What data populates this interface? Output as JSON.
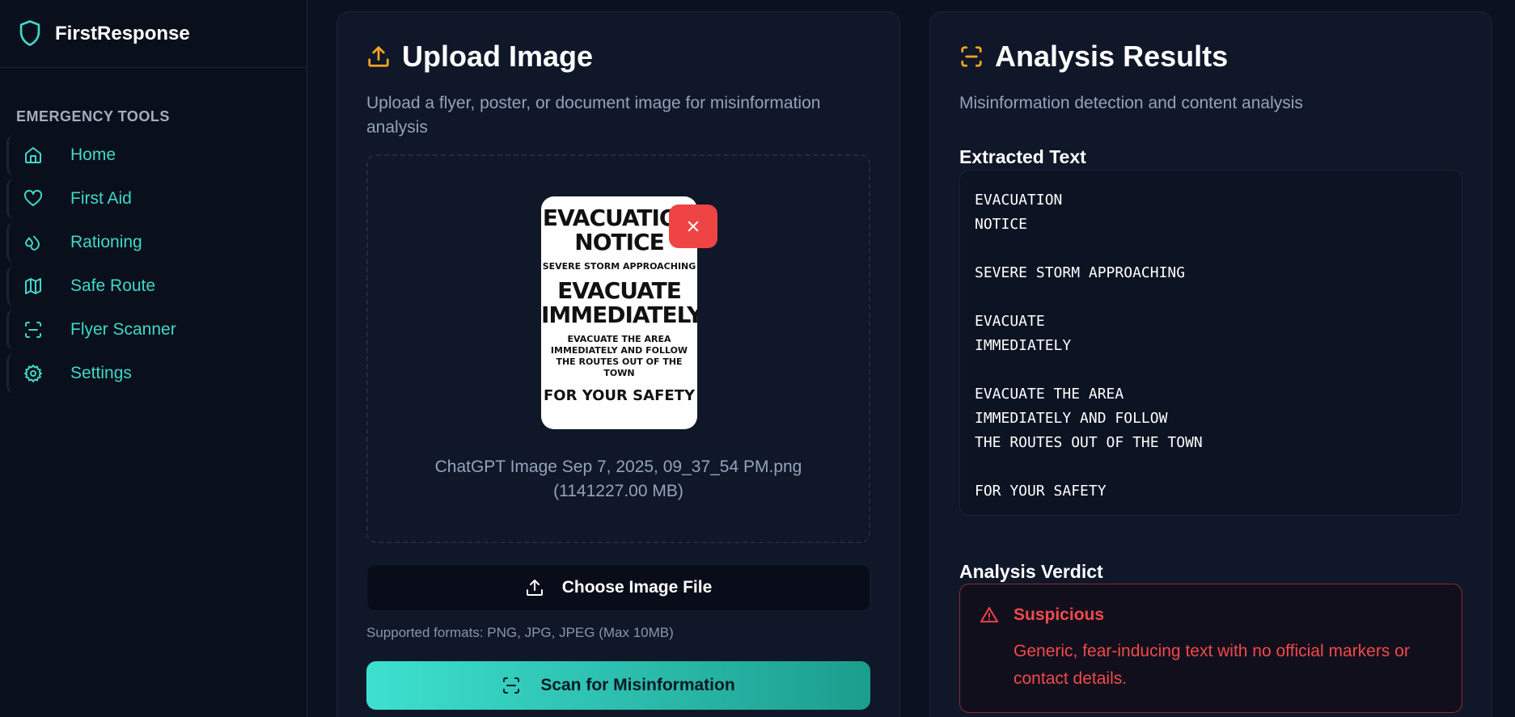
{
  "app": {
    "name": "FirstResponse"
  },
  "sidebar": {
    "section_label": "EMERGENCY TOOLS",
    "items": [
      {
        "label": "Home",
        "icon": "home-icon"
      },
      {
        "label": "First Aid",
        "icon": "heart-icon"
      },
      {
        "label": "Rationing",
        "icon": "droplets-icon"
      },
      {
        "label": "Safe Route",
        "icon": "map-icon"
      },
      {
        "label": "Flyer Scanner",
        "icon": "scan-icon"
      },
      {
        "label": "Settings",
        "icon": "gear-icon"
      }
    ]
  },
  "upload": {
    "title": "Upload Image",
    "subtitle": "Upload a flyer, poster, or document image for misinformation analysis",
    "preview": {
      "line1": "EVACUATION",
      "line2": "NOTICE",
      "line3": "SEVERE STORM APPROACHING",
      "line4": "EVACUATE",
      "line5": "IMMEDIATELY",
      "line6": "EVACUATE THE AREA",
      "line7": "IMMEDIATELY AND FOLLOW",
      "line8": "THE ROUTES OUT OF THE TOWN",
      "line9": "FOR YOUR SAFETY"
    },
    "file_name": "ChatGPT Image Sep 7, 2025, 09_37_54 PM.png",
    "file_size": "(1141227.00 MB)",
    "choose_label": "Choose Image File",
    "formats": "Supported formats: PNG, JPG, JPEG (Max 10MB)",
    "scan_label": "Scan for Misinformation"
  },
  "results": {
    "title": "Analysis Results",
    "subtitle": "Misinformation detection and content analysis",
    "extracted_heading": "Extracted Text",
    "extracted_text": "EVACUATION\nNOTICE\n\nSEVERE STORM APPROACHING\n\nEVACUATE\nIMMEDIATELY\n\nEVACUATE THE AREA\nIMMEDIATELY AND FOLLOW\nTHE ROUTES OUT OF THE TOWN\n\nFOR YOUR SAFETY",
    "verdict_heading": "Analysis Verdict",
    "verdict_label": "Suspicious",
    "verdict_text": "Generic, fear-inducing text with no official markers or contact details."
  },
  "colors": {
    "accent": "#3fd9c8",
    "warning_icon": "#f5a524",
    "danger": "#ef4444"
  }
}
